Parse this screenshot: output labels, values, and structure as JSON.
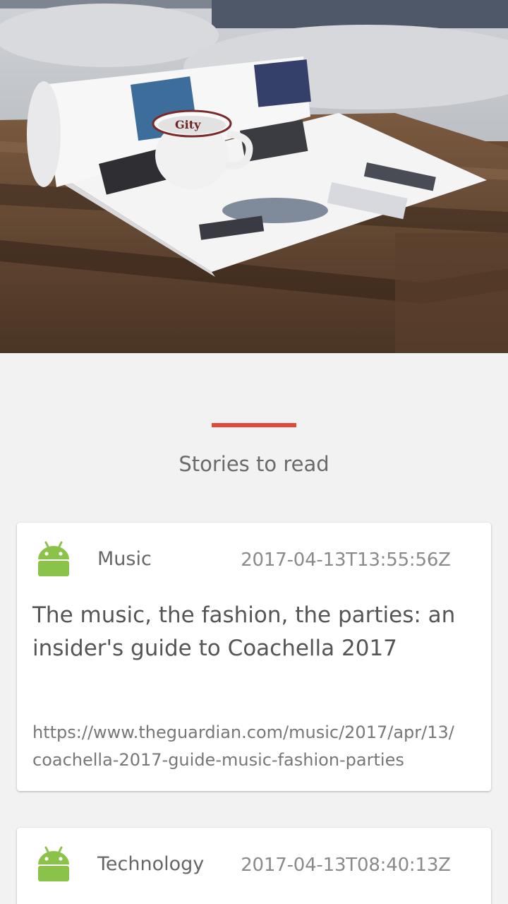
{
  "hero": {
    "image_description_icon": "newspaper-coffee-photo",
    "image_label": "Gity"
  },
  "section": {
    "title": "Stories to read",
    "accent_color": "#e04a3a"
  },
  "articles": [
    {
      "section_name": "Music",
      "icon": "android-icon",
      "published": "2017-04-13T13:55:56Z",
      "title": "The music, the fashion, the parties: an insider's guide to Coachella 2017",
      "url_line1": "https://www.theguardian.com/music/2017/apr/13/",
      "url_line2": "coachella-2017-guide-music-fashion-parties"
    },
    {
      "section_name": "Technology",
      "icon": "android-icon",
      "published": "2017-04-13T08:40:13Z"
    }
  ],
  "colors": {
    "background": "#f2f2f2",
    "card": "#ffffff",
    "android_green": "#8bc34a"
  }
}
